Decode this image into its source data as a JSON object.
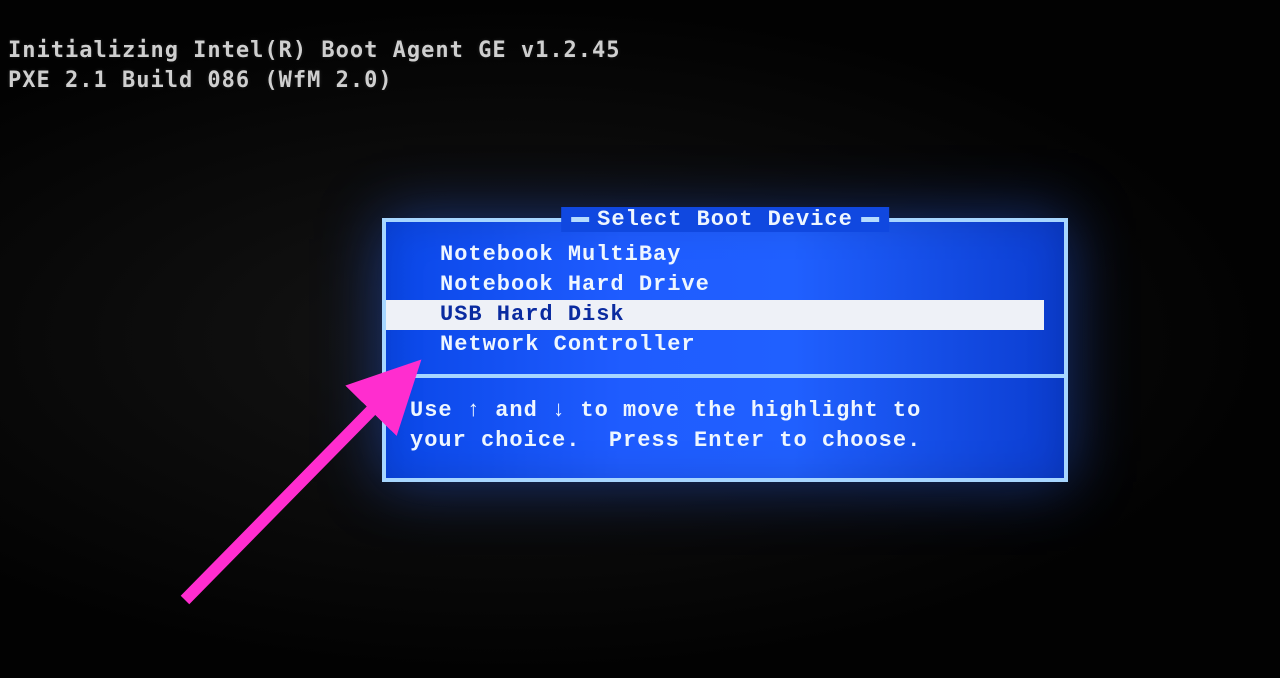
{
  "post": {
    "line1": "Initializing Intel(R) Boot Agent GE v1.2.45",
    "line2": "PXE 2.1 Build 086 (WfM 2.0)"
  },
  "dialog": {
    "title": "Select Boot Device",
    "options": [
      {
        "label": "Notebook MultiBay",
        "selected": false
      },
      {
        "label": "Notebook Hard Drive",
        "selected": false
      },
      {
        "label": "USB Hard Disk",
        "selected": true
      },
      {
        "label": "Network Controller",
        "selected": false
      }
    ],
    "hint": "Use ↑ and ↓ to move the highlight to\nyour choice.  Press Enter to choose."
  },
  "annotation": {
    "arrow_color": "#ff2dcf"
  }
}
